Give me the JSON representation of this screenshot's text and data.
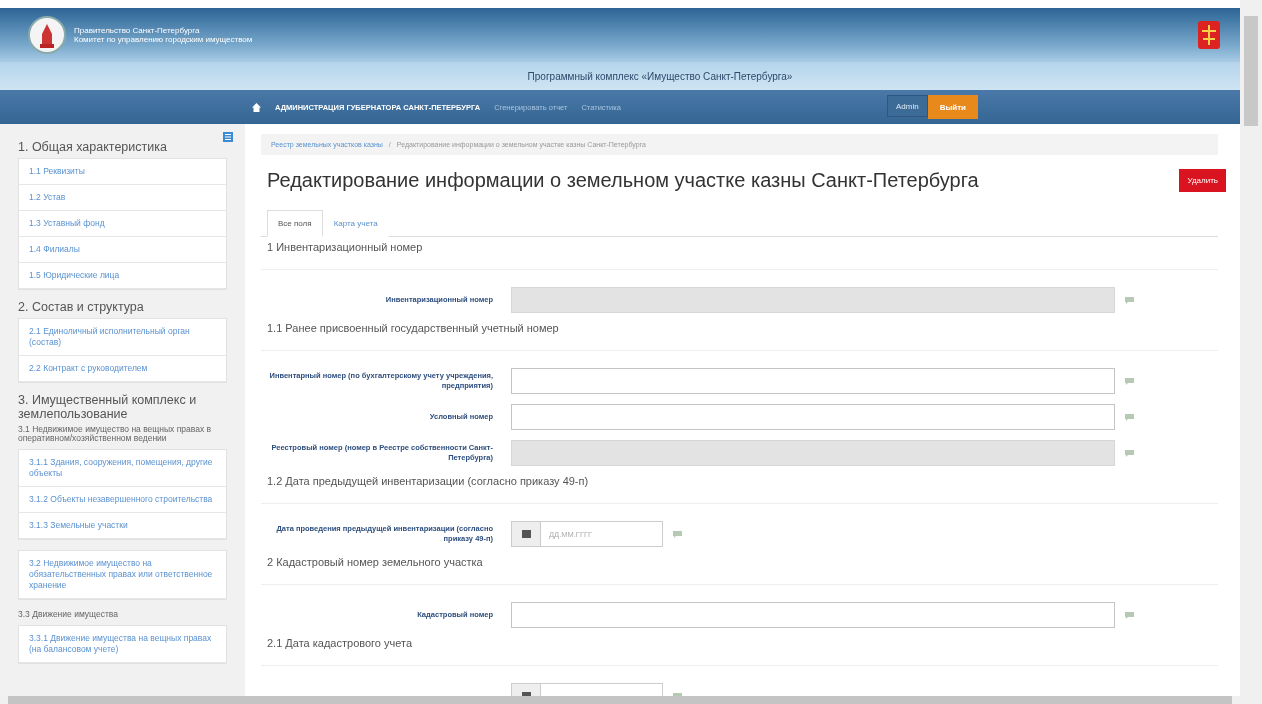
{
  "header": {
    "org_lines": [
      "Правительство Санкт-Петербурга",
      "Комитет по управлению городским имуществом"
    ],
    "subtitle": "Программный комплекс «Имущество Санкт-Петербурга»"
  },
  "nav": {
    "items": [
      {
        "label": "АДМИНИСТРАЦИЯ ГУБЕРНАТОРА САНКТ-ПЕТЕРБУРГА",
        "selected": true
      },
      {
        "label": "Сгенерировать отчет",
        "selected": false
      },
      {
        "label": "Статистика",
        "selected": false
      }
    ],
    "user_button": "Admin",
    "logout_button": "Выйти"
  },
  "sidebar": {
    "sections": [
      {
        "title": "1. Общая характеристика",
        "groups": [
          {
            "items": [
              "1.1 Реквизиты",
              "1.2 Устав",
              "1.3 Уставный фонд",
              "1.4 Филиалы",
              "1.5 Юридические лица"
            ]
          }
        ]
      },
      {
        "title": "2. Состав и структура",
        "groups": [
          {
            "items": [
              "2.1 Единоличный исполнительный орган (состав)",
              "2.2 Контракт с руководителем"
            ]
          }
        ]
      },
      {
        "title": "3. Имущественный комплекс и землепользование",
        "groups": [
          {
            "subtitle": "3.1 Недвижимое имущество на вещных правах в оперативном/хозяйственном ведении",
            "items": [
              "3.1.1 Здания, сооружения, помещения, другие объекты",
              "3.1.2 Объекты незавершенного строительства",
              "3.1.3 Земельные участки"
            ]
          },
          {
            "items": [
              "3.2 Недвижимое имущество на обязательственных правах или ответственное хранение"
            ]
          },
          {
            "subtitle": "3.3 Движение имущества",
            "items": [
              "3.3.1 Движение имущества на вещных правах (на балансовом учете)"
            ]
          }
        ]
      }
    ]
  },
  "breadcrumb": [
    {
      "label": "Реестр земельных участков казны",
      "kind": "link"
    },
    {
      "label": "/",
      "kind": "separator"
    },
    {
      "label": "Редактирование информации о земельном участке казны Санкт-Петербурга",
      "kind": "current"
    }
  ],
  "page_title": "Редактирование информации о земельном участке казны Санкт-Петербурга",
  "delete_button": "Удалить",
  "tabs": [
    {
      "label": "Все поля",
      "selected": true
    },
    {
      "label": "Карта учета",
      "selected": false
    }
  ],
  "form": [
    {
      "heading": "1 Инвентаризационный номер",
      "fields": [
        {
          "label": "Инвентаризационный номер",
          "kind": "text",
          "disabled": true
        }
      ]
    },
    {
      "heading": "1.1 Ранее присвоенный государственный учетный номер",
      "fields": [
        {
          "label": "Инвентарный номер (по бухгалтерскому учету учреждения, предприятия)",
          "kind": "text",
          "disabled": false
        },
        {
          "label": "Условный номер",
          "kind": "text",
          "disabled": false
        },
        {
          "label": "Реестровый номер (номер в Реестре собственности Санкт-Петербурга)",
          "kind": "text",
          "disabled": true
        }
      ]
    },
    {
      "heading": "1.2 Дата предыдущей инвентаризации (согласно приказу 49-п)",
      "fields": [
        {
          "label": "Дата проведения предыдущей инвентаризации (согласно приказу 49-п)",
          "kind": "date",
          "disabled": false,
          "placeholder": "ДД.ММ.ГГГГ"
        }
      ]
    },
    {
      "heading": "2 Кадастровый номер земельного участка",
      "fields": [
        {
          "label": "Кадастровый номер",
          "kind": "text",
          "disabled": false
        }
      ]
    },
    {
      "heading": "2.1 Дата кадастрового учета",
      "fields": [
        {
          "kind": "date",
          "disabled": false
        }
      ]
    }
  ]
}
